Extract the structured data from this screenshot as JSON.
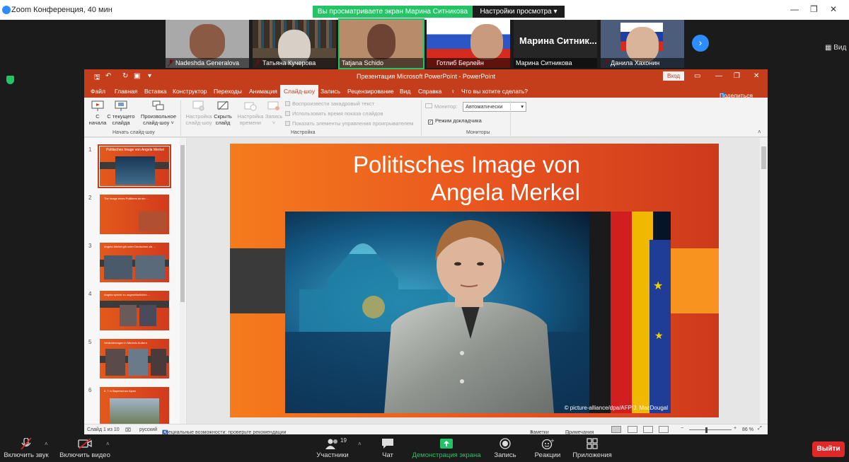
{
  "zoom": {
    "window_title": "Zoom Конференция, 40 мин",
    "share_banner": "Вы просматриваете экран Марина Ситникова",
    "view_options": "Настройки просмотра ▾",
    "view_mode": "Вид",
    "participants": [
      {
        "name": "Nadeshda Generalova",
        "muted": true
      },
      {
        "name": "Татьяна Кучерова",
        "muted": true
      },
      {
        "name": "Tatjana Schido",
        "muted": false
      },
      {
        "name": "Готлиб Берлейн",
        "muted": true
      },
      {
        "name": "Марина Ситникова",
        "card_title": "Марина  Ситник...",
        "muted": false
      },
      {
        "name": "Данила Хахонин",
        "muted": true
      }
    ],
    "toolbar": {
      "audio": "Включить звук",
      "video": "Включить видео",
      "participants": "Участники",
      "participants_count": "19",
      "chat": "Чат",
      "share": "Демонстрация экрана",
      "record": "Запись",
      "reactions": "Реакции",
      "apps": "Приложения",
      "leave": "Выйти"
    }
  },
  "powerpoint": {
    "title": "Презентация Microsoft PowerPoint  -  PowerPoint",
    "login": "Вход",
    "share": "Поделиться",
    "tell_me": "Что вы хотите сделать?",
    "tabs": [
      "Файл",
      "Главная",
      "Вставка",
      "Конструктор",
      "Переходы",
      "Анимация",
      "Слайд-шоу",
      "Запись",
      "Рецензирование",
      "Вид",
      "Справка"
    ],
    "active_tab": "Слайд-шоу",
    "ribbon": {
      "from_start": [
        "С",
        "начала"
      ],
      "from_current": [
        "С текущего",
        "слайда"
      ],
      "custom": [
        "Произвольное",
        "слайд-шоу ˅"
      ],
      "group_start": "Начать слайд-шоу",
      "setup": [
        "Настройка",
        "слайд-шоу"
      ],
      "hide": [
        "Скрыть",
        "слайд"
      ],
      "rehearse": [
        "Настройка",
        "времени"
      ],
      "record": [
        "Запись",
        "˅"
      ],
      "chk_narration": "Воспроизвести закадровый текст",
      "chk_timings": "Использовать время показа слайдов",
      "chk_media": "Показать элементы управления проигрывателем",
      "group_setup": "Настройка",
      "monitor_label": "Монитор:",
      "monitor_value": "Автоматически",
      "presenter_view": "Режим докладчика",
      "group_monitors": "Мониторы"
    },
    "slide_numbers": [
      "1",
      "2",
      "3",
      "4",
      "5",
      "6"
    ],
    "thumb_texts": [
      "Politisches Image von Angela Merkel",
      "The image eines Politikers ist ein ...",
      "Angela Merkel gilt unter Deutschen als ...",
      "Angela spricht zu ungewöhnlichen ...",
      "Veränderungen in Merkels Äußern",
      "8. 7 in Bayerischen Alpen"
    ],
    "slide": {
      "title_line1": "Politisches Image von",
      "title_line2": "Angela Merkel",
      "photo_credit": "© picture-alliance/dpa/AFP/J. MacDougal"
    },
    "status": {
      "slide_count": "Слайд 1 из 10",
      "language": "русский",
      "accessibility": "Специальные возможности: проверьте рекомендации",
      "notes": "Заметки",
      "comments": "Примечания",
      "zoom": "86 %"
    }
  },
  "colors": {
    "zoom_green": "#23c466",
    "zoom_blue": "#2d8cff",
    "ppt_accent": "#c43e1c",
    "leave_red": "#e02828"
  }
}
